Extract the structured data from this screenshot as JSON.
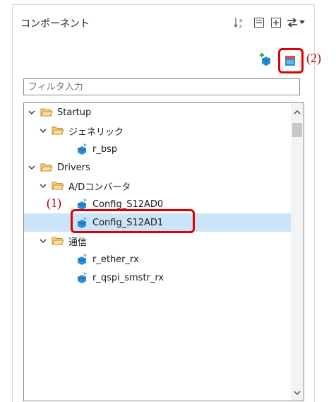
{
  "panel": {
    "title": "コンポーネント",
    "toolbar_icons": [
      "sort-az-icon",
      "collapse-all-icon",
      "expand-all-icon",
      "link-editor-icon",
      "view-menu-icon"
    ],
    "action_icons": [
      "add-component-icon",
      "component-library-icon"
    ]
  },
  "filter": {
    "placeholder": "フィルタ入力"
  },
  "tree": {
    "items": [
      {
        "label": "Startup"
      },
      {
        "label": "ジェネリック"
      },
      {
        "label": "r_bsp"
      },
      {
        "label": "Drivers"
      },
      {
        "label": "A/Dコンバータ"
      },
      {
        "label": "Config_S12AD0"
      },
      {
        "label": "Config_S12AD1",
        "selected": true
      },
      {
        "label": "通信"
      },
      {
        "label": "r_ether_rx"
      },
      {
        "label": "r_qspi_smstr_rx"
      }
    ]
  },
  "annotations": {
    "a1": "(1)",
    "a2": "(2)"
  },
  "colors": {
    "selection": "#cce4f7",
    "highlight": "#e00000",
    "annotation": "#c00000",
    "folder": "#e8a53a",
    "component": "#2a8fd8"
  }
}
